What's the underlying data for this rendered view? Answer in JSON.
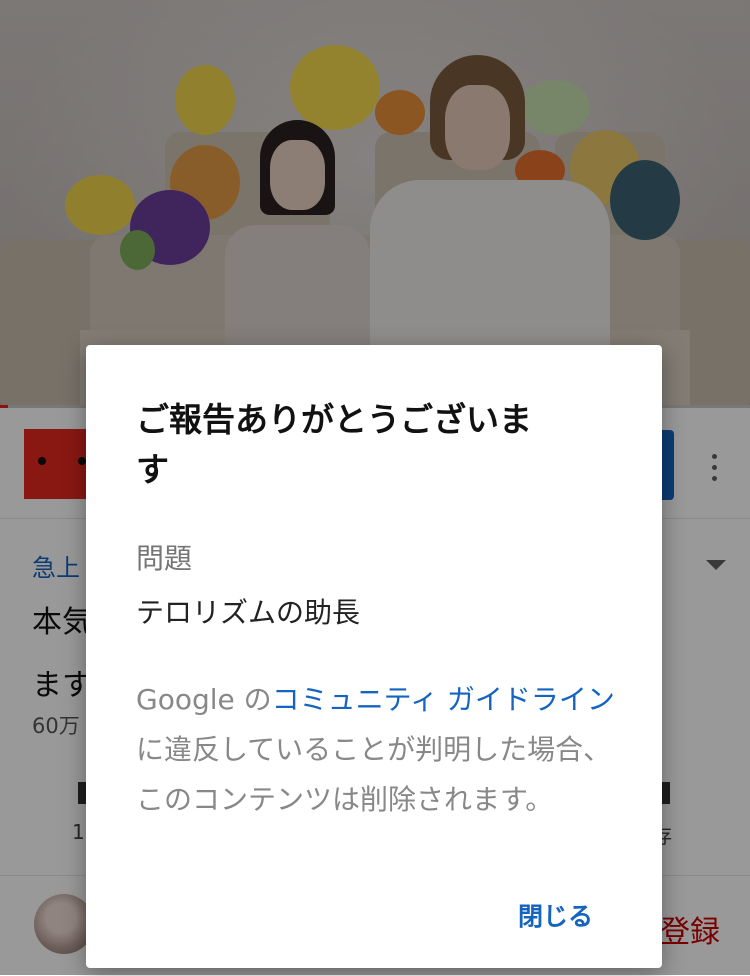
{
  "video": {
    "progress_percent": 1
  },
  "page": {
    "trending_tag": "急上",
    "title_line1": "本気",
    "title_line2": "ます",
    "views_peek": "60万",
    "action_label_left": "1",
    "action_label_right": "存",
    "register_label": "登録"
  },
  "dialog": {
    "title": "ご報告ありがとうございます",
    "issue_label": "問題",
    "issue_value": "テロリズムの助長",
    "body_prefix": "Google の",
    "guidelines_link": "コミュニティ ガイドライン",
    "body_suffix": "に違反していることが判明した場合、このコンテンツは削除されます。",
    "close_button": "閉じる"
  },
  "colors": {
    "link": "#1565c0",
    "progress": "#e62117",
    "brand_red": "#e5281f",
    "register": "#cc0000"
  }
}
